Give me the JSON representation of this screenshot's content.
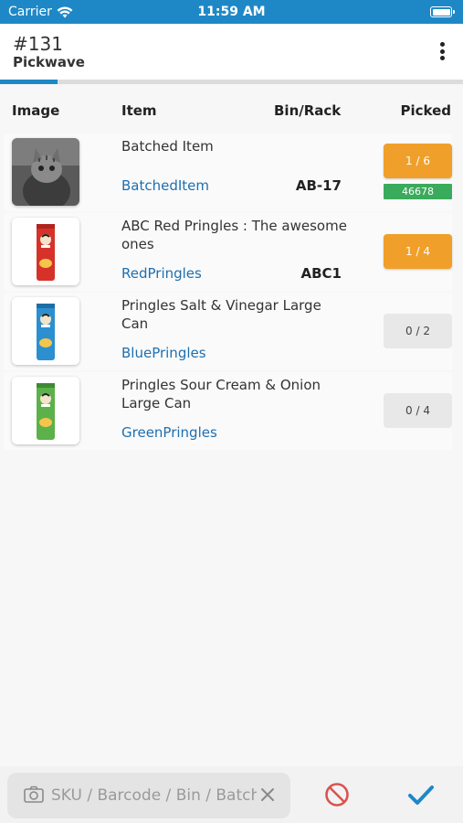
{
  "status_bar": {
    "carrier": "Carrier",
    "time": "11:59 AM"
  },
  "header": {
    "number": "#131",
    "title": "Pickwave"
  },
  "progress": {
    "fraction": 0.125,
    "color": "#1e88c6"
  },
  "table": {
    "columns": {
      "image": "Image",
      "item": "Item",
      "bin": "Bin/Rack",
      "picked": "Picked"
    },
    "rows": [
      {
        "name": "Batched Item",
        "sku": "BatchedItem",
        "bin": "AB-17",
        "picked": "1 / 6",
        "status": "orange",
        "batch": "46678",
        "image": "cat-photo"
      },
      {
        "name": "ABC Red Pringles : The awesome ones",
        "sku": "RedPringles",
        "bin": "ABC1",
        "picked": "1 / 4",
        "status": "orange",
        "image": "red-pringles-can"
      },
      {
        "name": "Pringles Salt & Vinegar Large Can",
        "sku": "BluePringles",
        "bin": "",
        "picked": "0 / 2",
        "status": "gray",
        "image": "blue-pringles-can"
      },
      {
        "name": "Pringles Sour Cream & Onion Large Can",
        "sku": "GreenPringles",
        "bin": "",
        "picked": "0 / 4",
        "status": "gray",
        "image": "green-pringles-can"
      }
    ]
  },
  "search": {
    "placeholder": "SKU / Barcode / Bin / Batch"
  },
  "colors": {
    "accent": "#1e88c6",
    "orange": "#f0a02a",
    "green": "#3aaa5c",
    "cancel": "#d9534f",
    "link": "#1e6fb0"
  },
  "icons": {
    "camera": "camera-icon",
    "clear": "close-icon",
    "cancel": "cancel-icon",
    "confirm": "checkmark-icon",
    "menu": "more-vertical-icon",
    "wifi": "wifi-icon",
    "battery": "battery-icon"
  }
}
